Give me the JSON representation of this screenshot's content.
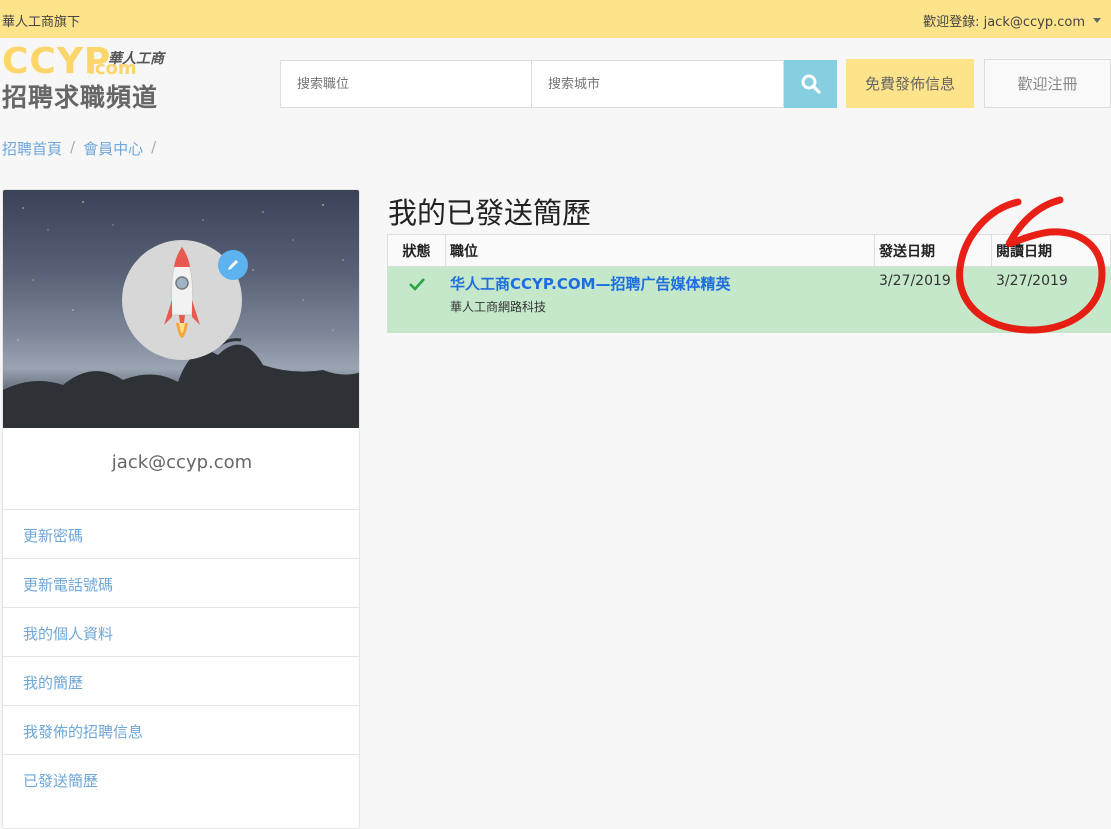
{
  "topbar": {
    "brand_text": "華人工商旗下",
    "welcome_text": "歡迎登錄: jack@ccyp.com"
  },
  "logo": {
    "ccyp": "CCYP",
    "dotcom": ".com",
    "chinese": "華人工商",
    "tagline": "招聘求職頻道"
  },
  "search": {
    "job_placeholder": "搜索職位",
    "city_placeholder": "搜索城市",
    "search_icon": "search-icon"
  },
  "header_buttons": {
    "post_label": "免費發佈信息",
    "register_label": "歡迎注冊"
  },
  "breadcrumb": {
    "items": [
      "招聘首頁",
      "會員中心"
    ],
    "separator": "/"
  },
  "profile": {
    "email": "jack@ccyp.com",
    "avatar_icon": "rocket-icon",
    "edit_icon": "pencil-icon",
    "menu": [
      {
        "label": "更新密碼"
      },
      {
        "label": "更新電話號碼"
      },
      {
        "label": "我的個人資料"
      },
      {
        "label": "我的簡歷"
      },
      {
        "label": "我發佈的招聘信息"
      },
      {
        "label": "已發送簡歷"
      }
    ]
  },
  "main": {
    "title": "我的已發送簡歷",
    "table": {
      "headers": [
        "狀態",
        "職位",
        "發送日期",
        "閱讀日期"
      ],
      "rows": [
        {
          "status_icon": "check-icon",
          "job_title": "华人工商CCYP.COM—招聘广告媒体精英",
          "company": "華人工商網路科技",
          "sent_date": "3/27/2019",
          "read_date": "3/27/2019"
        }
      ]
    }
  },
  "colors": {
    "topbar": "#fde38a",
    "accent_blue": "#6ea7d8",
    "link_blue": "#1e6ee0",
    "row_green": "#c5e8cb",
    "check_green": "#28a745",
    "annotation_red": "#e8140a"
  }
}
